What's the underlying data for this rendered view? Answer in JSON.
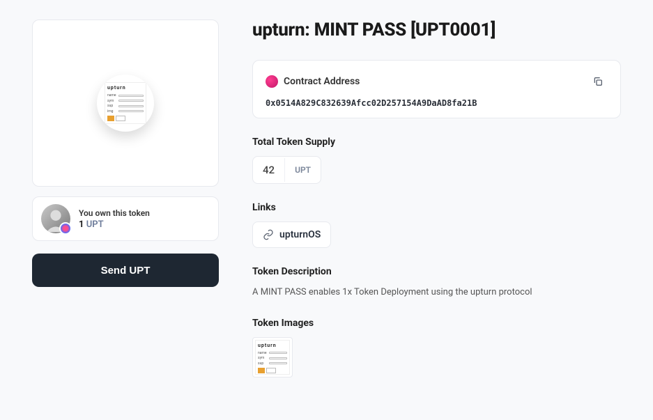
{
  "title": "upturn: MINT PASS [UPT0001]",
  "ownership": {
    "label": "You own this token",
    "amount": "1",
    "symbol": "UPT"
  },
  "send_button_label": "Send UPT",
  "contract": {
    "label": "Contract Address",
    "address": "0x0514A829C832639Afcc02D257154A9DaAD8fa21B"
  },
  "supply": {
    "label": "Total Token Supply",
    "value": "42",
    "symbol": "UPT"
  },
  "links": {
    "label": "Links",
    "items": [
      {
        "label": "upturnOS"
      }
    ]
  },
  "description": {
    "label": "Token Description",
    "text": "A MINT PASS enables 1x Token Deployment using the upturn protocol"
  },
  "images": {
    "label": "Token Images"
  }
}
